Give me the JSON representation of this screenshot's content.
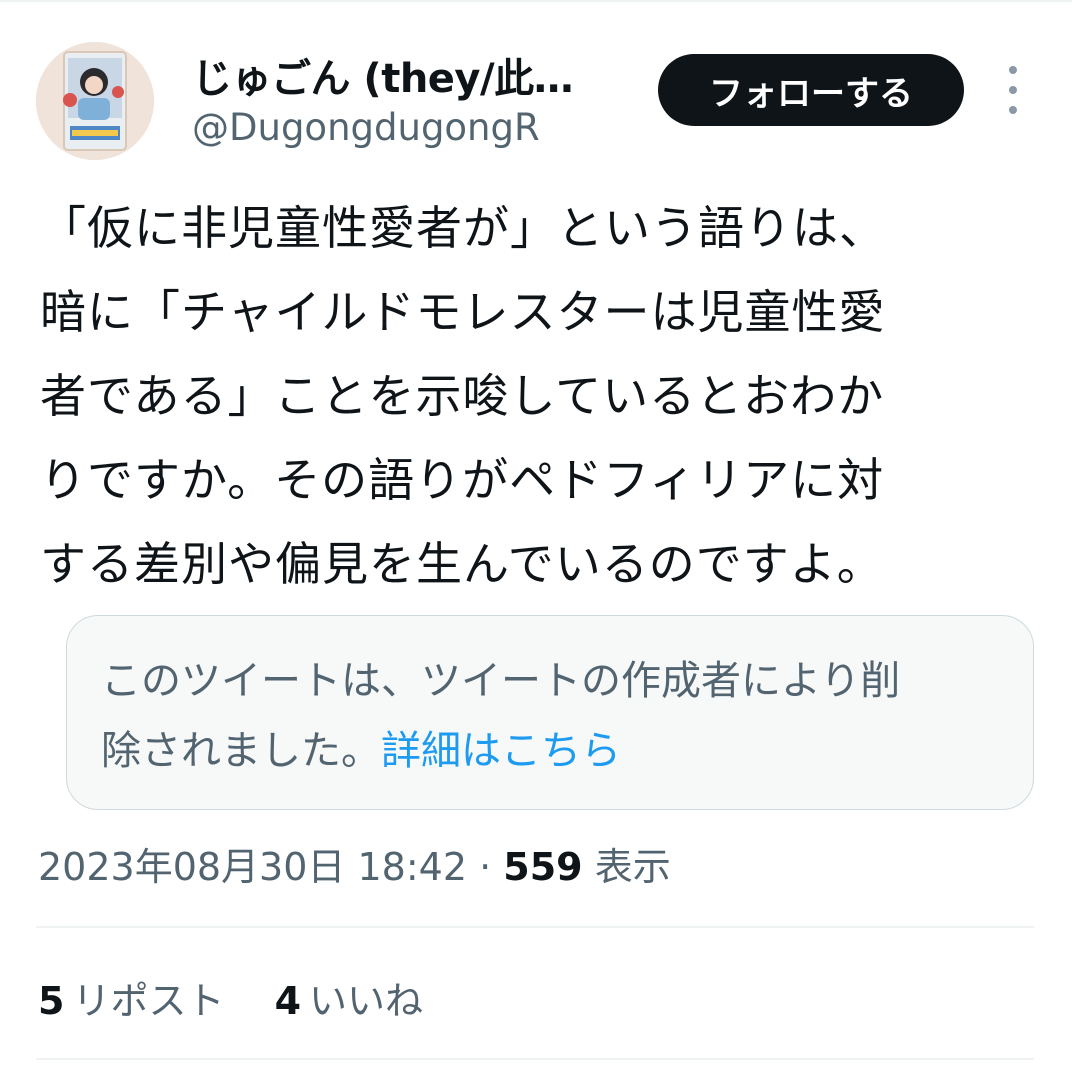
{
  "author": {
    "display_name": "じゅごん (they/此…",
    "handle": "@DugongdugongR"
  },
  "follow_button": {
    "label": "フォローする"
  },
  "tweet": {
    "lines": [
      "「仮に非児童性愛者が」という語りは、",
      "暗に「チャイルドモレスターは児童性愛",
      "者である」ことを示唆しているとおわか",
      "りですか。その語りがペドフィリアに対",
      "する差別や偏見を生んでいるのですよ。"
    ]
  },
  "quoted_tweet": {
    "line1": "このツイートは、ツイートの作成者により削",
    "line2": "除されました。",
    "link": "詳細はこちら"
  },
  "meta": {
    "timestamp": "2023年08月30日 18:42",
    "separator": "·",
    "views_count": "559",
    "views_label": "表示"
  },
  "stats": {
    "reposts_count": "5",
    "reposts_label": "リポスト",
    "likes_count": "4",
    "likes_label": "いいね"
  },
  "icons": {
    "more": "more-vertical-icon"
  },
  "colors": {
    "text": "#0f1419",
    "secondary": "#536471",
    "link": "#1d9bf0",
    "button": "#0f1419"
  }
}
